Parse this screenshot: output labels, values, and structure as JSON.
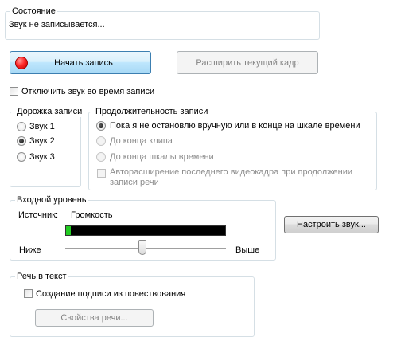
{
  "status": {
    "title": "Состояние",
    "message": "Звук не записывается..."
  },
  "buttons": {
    "start_record": "Начать запись",
    "extend_frame": "Расширить текущий кадр",
    "configure_audio": "Настроить звук...",
    "speech_properties": "Свойства речи..."
  },
  "mute_checkbox": {
    "label": "Отключить звук во время записи",
    "checked": false
  },
  "track": {
    "title": "Дорожка записи",
    "options": [
      {
        "label": "Звук 1",
        "checked": false
      },
      {
        "label": "Звук 2",
        "checked": true
      },
      {
        "label": "Звук 3",
        "checked": false
      }
    ]
  },
  "duration": {
    "title": "Продолжительность записи",
    "options": [
      {
        "label": "Пока я не остановлю вручную или в конце на шкале времени",
        "checked": true,
        "enabled": true
      },
      {
        "label": "До конца клипа",
        "checked": false,
        "enabled": false
      },
      {
        "label": "До конца шкалы времени",
        "checked": false,
        "enabled": false
      }
    ],
    "autoextend_line1": "Авторасширение последнего видеокадра при продолжении",
    "autoextend_line2": "записи речи"
  },
  "input_level": {
    "title": "Входной уровень",
    "source_label": "Источник:",
    "source_value": "Громкость",
    "meter_level": 0.03,
    "slider_value": 0.48,
    "low_label": "Ниже",
    "high_label": "Выше"
  },
  "speech_to_text": {
    "title": "Речь в текст",
    "caption_label": "Создание подписи из повествования",
    "caption_checked": false
  },
  "colors": {
    "group_border": "#d5dfe5",
    "meter_background": "#000000",
    "meter_fill": "#22cc22",
    "record_dot": "#ff2a2a",
    "disabled_text": "#8d8d8d"
  }
}
